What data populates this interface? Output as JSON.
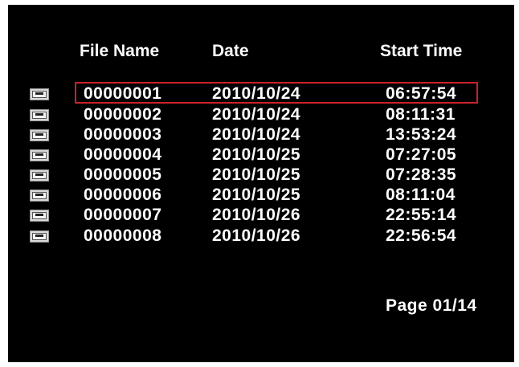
{
  "columns": {
    "file_name": "File Name",
    "date": "Date",
    "start_time": "Start Time"
  },
  "files": [
    {
      "name": "00000001",
      "date": "2010/10/24",
      "start_time": "06:57:54"
    },
    {
      "name": "00000002",
      "date": "2010/10/24",
      "start_time": "08:11:31"
    },
    {
      "name": "00000003",
      "date": "2010/10/24",
      "start_time": "13:53:24"
    },
    {
      "name": "00000004",
      "date": "2010/10/25",
      "start_time": "07:27:05"
    },
    {
      "name": "00000005",
      "date": "2010/10/25",
      "start_time": "07:28:35"
    },
    {
      "name": "00000006",
      "date": "2010/10/25",
      "start_time": "08:11:04"
    },
    {
      "name": "00000007",
      "date": "2010/10/26",
      "start_time": "22:55:14"
    },
    {
      "name": "00000008",
      "date": "2010/10/26",
      "start_time": "22:56:54"
    }
  ],
  "selected_index": 0,
  "pagination": {
    "label": "Page 01/14"
  },
  "colors": {
    "background": "#000000",
    "text": "#ffffff",
    "selection": "#c8222a"
  },
  "icons": {
    "file": "file-icon"
  }
}
